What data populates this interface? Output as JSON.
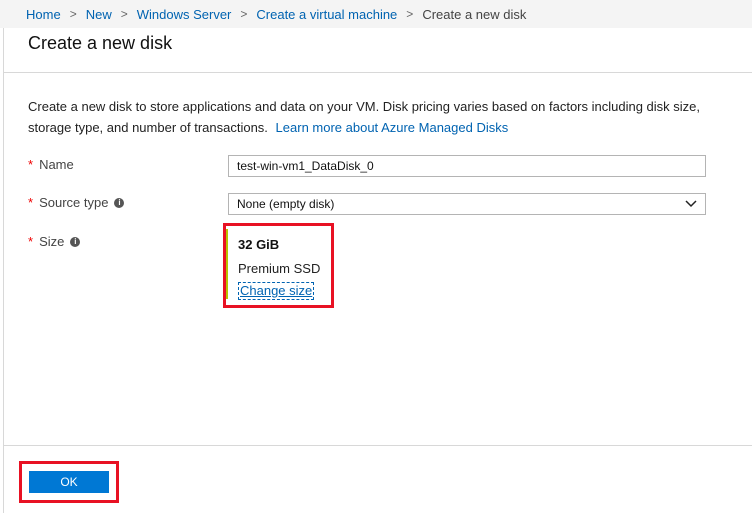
{
  "breadcrumb": {
    "items": [
      "Home",
      "New",
      "Windows Server",
      "Create a virtual machine"
    ],
    "current": "Create a new disk"
  },
  "blade": {
    "title": "Create a new disk"
  },
  "description": {
    "text": "Create a new disk to store applications and data on your VM. Disk pricing varies based on factors including disk size, storage type, and number of transactions.",
    "link": "Learn more about Azure Managed Disks"
  },
  "form": {
    "name": {
      "label": "Name",
      "required": "*",
      "value": "test-win-vm1_DataDisk_0"
    },
    "source_type": {
      "label": "Source type",
      "required": "*",
      "value": "None (empty disk)"
    },
    "size": {
      "label": "Size",
      "required": "*",
      "value": "32 GiB",
      "tier": "Premium SSD",
      "change_link": "Change size"
    }
  },
  "footer": {
    "ok_label": "OK"
  },
  "colors": {
    "accent": "#0078d4",
    "link": "#0063b1",
    "highlight": "#e81123",
    "required": "#e00000",
    "size_bar": "#b7c400"
  },
  "icons": [
    "chevron-right-icon",
    "info-icon",
    "chevron-down-icon"
  ]
}
